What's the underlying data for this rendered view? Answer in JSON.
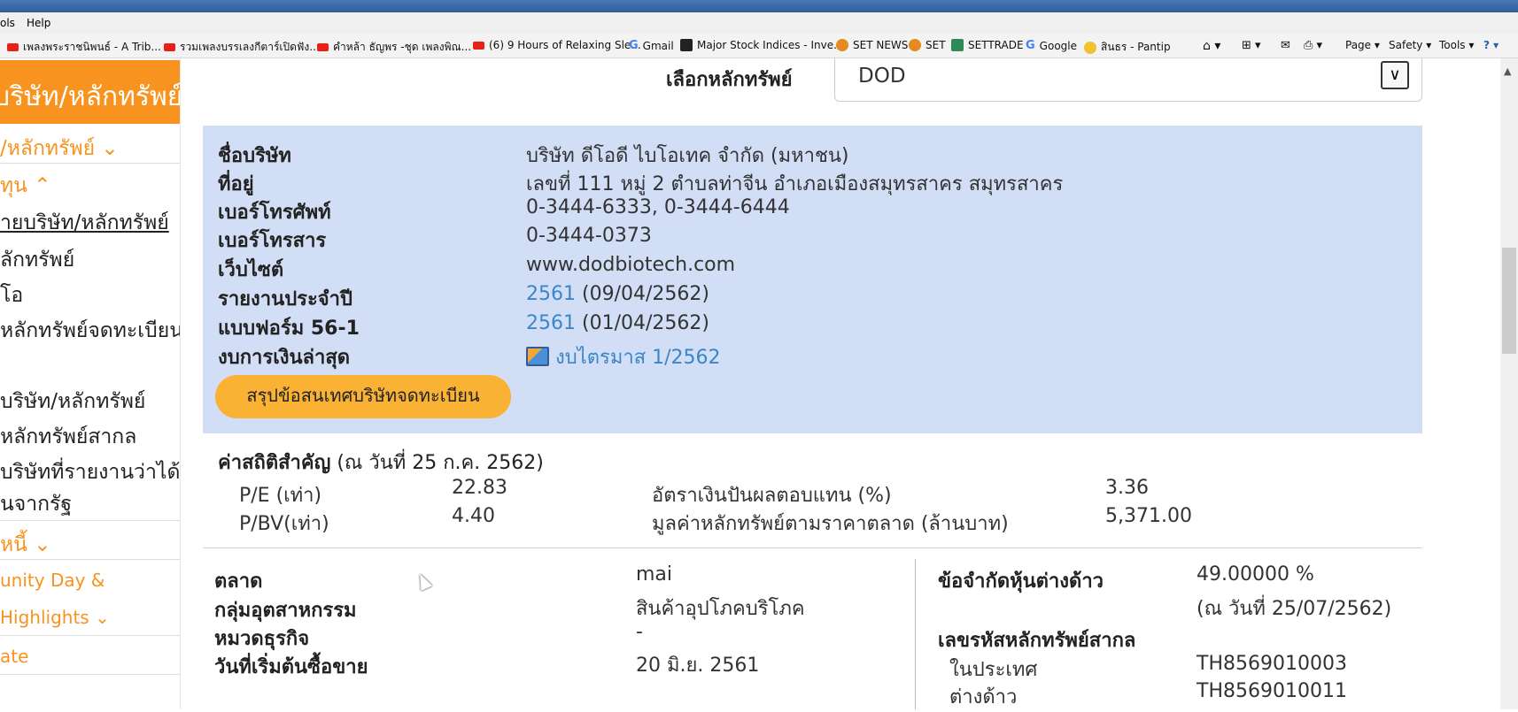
{
  "browser": {
    "menu": [
      "ols",
      "Help"
    ],
    "favorites": [
      {
        "label": "เพลงพระราชนิพนธ์ - A Trib...",
        "icon": "youtube-icon"
      },
      {
        "label": "รวมเพลงบรรเลงกีตาร์เปิดฟัง...",
        "icon": "youtube-icon"
      },
      {
        "label": "คำหล้า ธัญพร -ชุด เพลงพิณ...",
        "icon": "youtube-icon"
      },
      {
        "label": "(6) 9 Hours of Relaxing Sle...",
        "icon": "youtube-icon"
      },
      {
        "label": "Gmail",
        "icon": "google-icon"
      },
      {
        "label": "Major Stock Indices - Inve...",
        "icon": "investing-icon"
      },
      {
        "label": "SET NEWS",
        "icon": "set-icon"
      },
      {
        "label": "SET",
        "icon": "set-icon"
      },
      {
        "label": "SETTRADE",
        "icon": "settrade-icon"
      },
      {
        "label": "Google",
        "icon": "google-icon"
      },
      {
        "label": "สินธร - Pantip",
        "icon": "pantip-icon"
      }
    ],
    "tools": [
      "Page ▾",
      "Safety ▾",
      "Tools ▾"
    ]
  },
  "sidebar": {
    "header": "บริษัท/หลักทรัพย์",
    "items": [
      "/หลักทรัพย์",
      "ทุน",
      "ายบริษัท/หลักทรัพย์",
      "ลักทรัพย์",
      "โอ",
      "หลักทรัพย์จดทะเบียน",
      "บริษัท/หลักทรัพย์",
      "หลักทรัพย์สากล",
      "บริษัทที่รายงานว่าได้รับ",
      "นจากรัฐ",
      "หนี้",
      "unity Day &",
      "Highlights",
      "ate"
    ]
  },
  "selector": {
    "label": "เลือกหลักทรัพย์",
    "value": "DOD"
  },
  "company": {
    "name_label": "ชื่อบริษัท",
    "name": "บริษัท ดีโอดี ไบโอเทค จำกัด (มหาชน)",
    "address_label": "ที่อยู่",
    "address": "เลขที่ 111 หมู่ 2 ตำบลท่าจีน อำเภอเมืองสมุทรสาคร สมุทรสาคร",
    "phone_label": "เบอร์โทรศัพท์",
    "phone": "0-3444-6333, 0-3444-6444",
    "fax_label": "เบอร์โทรสาร",
    "fax": "0-3444-0373",
    "website_label": "เว็บไซต์",
    "website": "www.dodbiotech.com",
    "annual_label": "รายงานประจำปี",
    "annual_year": "2561",
    "annual_date": "(09/04/2562)",
    "form_label": "แบบฟอร์ม 56-1",
    "form_year": "2561",
    "form_date": "(01/04/2562)",
    "fin_label": "งบการเงินล่าสุด",
    "fin_link": "งบไตรมาส 1/2562",
    "summary_button": "สรุปข้อสนเทศบริษัทจดทะเบียน"
  },
  "stats": {
    "title_bold": "ค่าสถิติสำคัญ",
    "title_date": " (ณ วันที่ 25 ก.ค. 2562)",
    "pe_label": "P/E (เท่า)",
    "pe": "22.83",
    "pbv_label": "P/BV(เท่า)",
    "pbv": "4.40",
    "div_label": "อัตราเงินปันผลตอบแทน (%)",
    "div": "3.36",
    "mcap_label": "มูลค่าหลักทรัพย์ตามราคาตลาด (ล้านบาท)",
    "mcap": "5,371.00"
  },
  "details": {
    "market_label": "ตลาด",
    "market": "mai",
    "industry_label": "กลุ่มอุตสาหกรรม",
    "industry": "สินค้าอุปโภคบริโภค",
    "sector_label": "หมวดธุรกิจ",
    "sector": "-",
    "start_label": "วันที่เริ่มต้นซื้อขาย",
    "start": "20 มิ.ย. 2561",
    "foreign_label": "ข้อจำกัดหุ้นต่างด้าว",
    "foreign": "49.00000 %",
    "foreign_date": "(ณ วันที่ 25/07/2562)",
    "isin_label": "เลขรหัสหลักทรัพย์สากล",
    "isin_local_label": "ในประเทศ",
    "isin_local": "TH8569010003",
    "isin_foreign_label": "ต่างด้าว",
    "isin_foreign": "TH8569010011"
  }
}
